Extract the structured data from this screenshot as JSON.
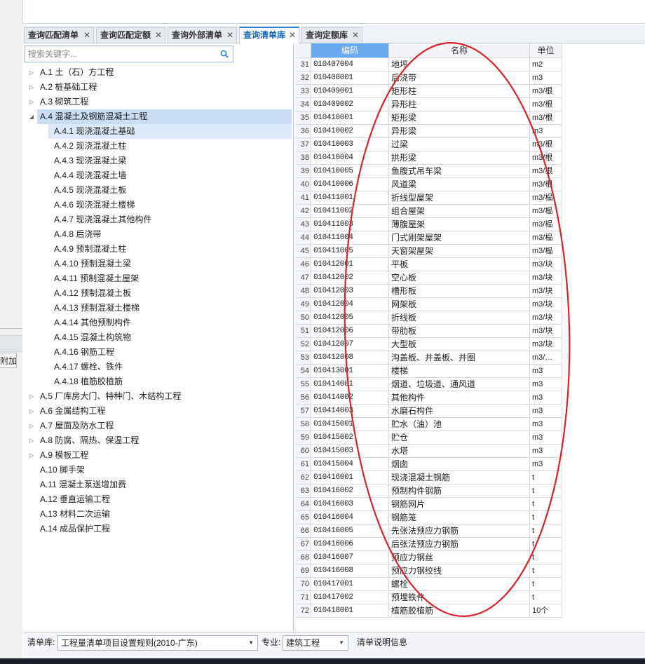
{
  "tabs": [
    {
      "label": "查询匹配清单",
      "active": false
    },
    {
      "label": "查询匹配定额",
      "active": false
    },
    {
      "label": "查询外部清单",
      "active": false
    },
    {
      "label": "查询清单库",
      "active": true
    },
    {
      "label": "查询定额库",
      "active": false
    }
  ],
  "left_strip_button": "附加",
  "search": {
    "placeholder": "搜索关键字..."
  },
  "tree": [
    {
      "label": "A.1 土（石）方工程",
      "level": 0,
      "caret": "right"
    },
    {
      "label": "A.2 桩基础工程",
      "level": 0,
      "caret": "right"
    },
    {
      "label": "A.3 砌筑工程",
      "level": 0,
      "caret": "right"
    },
    {
      "label": "A.4 混凝土及钢筋混凝土工程",
      "level": 0,
      "caret": "down",
      "highlight": true
    },
    {
      "label": "A.4.1 现浇混凝土基础",
      "level": 1,
      "selected": true
    },
    {
      "label": "A.4.2 现浇混凝土柱",
      "level": 1
    },
    {
      "label": "A.4.3 现浇混凝土梁",
      "level": 1
    },
    {
      "label": "A.4.4 现浇混凝土墙",
      "level": 1
    },
    {
      "label": "A.4.5 现浇混凝土板",
      "level": 1
    },
    {
      "label": "A.4.6 现浇混凝土楼梯",
      "level": 1
    },
    {
      "label": "A.4.7 现浇混凝土其他构件",
      "level": 1
    },
    {
      "label": "A.4.8 后浇带",
      "level": 1
    },
    {
      "label": "A.4.9 预制混凝土柱",
      "level": 1
    },
    {
      "label": "A.4.10 预制混凝土梁",
      "level": 1
    },
    {
      "label": "A.4.11 预制混凝土屋架",
      "level": 1
    },
    {
      "label": "A.4.12 预制混凝土板",
      "level": 1
    },
    {
      "label": "A.4.13 预制混凝土楼梯",
      "level": 1
    },
    {
      "label": "A.4.14 其他预制构件",
      "level": 1
    },
    {
      "label": "A.4.15 混凝土构筑物",
      "level": 1
    },
    {
      "label": "A.4.16 钢筋工程",
      "level": 1
    },
    {
      "label": "A.4.17 螺栓、铁件",
      "level": 1
    },
    {
      "label": "A.4.18 植筋胶植筋",
      "level": 1
    },
    {
      "label": "A.5 厂库房大门、特种门、木结构工程",
      "level": 0,
      "caret": "right"
    },
    {
      "label": "A.6 金属结构工程",
      "level": 0,
      "caret": "right"
    },
    {
      "label": "A.7 屋面及防水工程",
      "level": 0,
      "caret": "right"
    },
    {
      "label": "A.8 防腐、隔热、保温工程",
      "level": 0,
      "caret": "right"
    },
    {
      "label": "A.9 模板工程",
      "level": 0,
      "caret": "right"
    },
    {
      "label": "A.10 脚手架",
      "level": 0
    },
    {
      "label": "A.11 混凝土泵送增加费",
      "level": 0
    },
    {
      "label": "A.12 垂直运输工程",
      "level": 0
    },
    {
      "label": "A.13 材料二次运输",
      "level": 0
    },
    {
      "label": "A.14 成品保护工程",
      "level": 0
    }
  ],
  "grid": {
    "columns": {
      "code": "编码",
      "name": "名称",
      "unit": "单位"
    },
    "rows": [
      {
        "no": "31",
        "code": "010407004",
        "name": "地坪",
        "unit": "m2"
      },
      {
        "no": "32",
        "code": "010408001",
        "name": "后浇带",
        "unit": "m3"
      },
      {
        "no": "33",
        "code": "010409001",
        "name": "矩形柱",
        "unit": "m3/根"
      },
      {
        "no": "34",
        "code": "010409002",
        "name": "异形柱",
        "unit": "m3/根"
      },
      {
        "no": "35",
        "code": "010410001",
        "name": "矩形梁",
        "unit": "m3/根"
      },
      {
        "no": "36",
        "code": "010410002",
        "name": "异形梁",
        "unit": "m3"
      },
      {
        "no": "37",
        "code": "010410003",
        "name": "过梁",
        "unit": "m3/根"
      },
      {
        "no": "38",
        "code": "010410004",
        "name": "拱形梁",
        "unit": "m3/根"
      },
      {
        "no": "39",
        "code": "010410005",
        "name": "鱼腹式吊车梁",
        "unit": "m3/根"
      },
      {
        "no": "40",
        "code": "010410006",
        "name": "风道梁",
        "unit": "m3/根"
      },
      {
        "no": "41",
        "code": "010411001",
        "name": "折线型屋架",
        "unit": "m3/榀"
      },
      {
        "no": "42",
        "code": "010411002",
        "name": "组合屋架",
        "unit": "m3/榀"
      },
      {
        "no": "43",
        "code": "010411003",
        "name": "薄腹屋架",
        "unit": "m3/榀"
      },
      {
        "no": "44",
        "code": "010411004",
        "name": "门式刚架屋架",
        "unit": "m3/榀"
      },
      {
        "no": "45",
        "code": "010411005",
        "name": "天窗架屋架",
        "unit": "m3/榀"
      },
      {
        "no": "46",
        "code": "010412001",
        "name": "平板",
        "unit": "m3/块"
      },
      {
        "no": "47",
        "code": "010412002",
        "name": "空心板",
        "unit": "m3/块"
      },
      {
        "no": "48",
        "code": "010412003",
        "name": "槽形板",
        "unit": "m3/块"
      },
      {
        "no": "49",
        "code": "010412004",
        "name": "网架板",
        "unit": "m3/块"
      },
      {
        "no": "50",
        "code": "010412005",
        "name": "折线板",
        "unit": "m3/块"
      },
      {
        "no": "51",
        "code": "010412006",
        "name": "带肋板",
        "unit": "m3/块"
      },
      {
        "no": "52",
        "code": "010412007",
        "name": "大型板",
        "unit": "m3/块"
      },
      {
        "no": "53",
        "code": "010412008",
        "name": "沟盖板、井盖板、井圈",
        "unit": "m3/…"
      },
      {
        "no": "54",
        "code": "010413001",
        "name": "楼梯",
        "unit": "m3"
      },
      {
        "no": "55",
        "code": "010414001",
        "name": "烟道、垃圾道、通风道",
        "unit": "m3"
      },
      {
        "no": "56",
        "code": "010414002",
        "name": "其他构件",
        "unit": "m3"
      },
      {
        "no": "57",
        "code": "010414003",
        "name": "水磨石构件",
        "unit": "m3"
      },
      {
        "no": "58",
        "code": "010415001",
        "name": "贮水（油）池",
        "unit": "m3"
      },
      {
        "no": "59",
        "code": "010415002",
        "name": "贮仓",
        "unit": "m3"
      },
      {
        "no": "60",
        "code": "010415003",
        "name": "水塔",
        "unit": "m3"
      },
      {
        "no": "61",
        "code": "010415004",
        "name": "烟囱",
        "unit": "m3"
      },
      {
        "no": "62",
        "code": "010416001",
        "name": "现浇混凝土钢筋",
        "unit": "t"
      },
      {
        "no": "63",
        "code": "010416002",
        "name": "预制构件钢筋",
        "unit": "t"
      },
      {
        "no": "64",
        "code": "010416003",
        "name": "钢筋网片",
        "unit": "t"
      },
      {
        "no": "65",
        "code": "010416004",
        "name": "钢筋笼",
        "unit": "t"
      },
      {
        "no": "66",
        "code": "010416005",
        "name": "先张法预应力钢筋",
        "unit": "t"
      },
      {
        "no": "67",
        "code": "010416006",
        "name": "后张法预应力钢筋",
        "unit": "t"
      },
      {
        "no": "68",
        "code": "010416007",
        "name": "预应力钢丝",
        "unit": "t"
      },
      {
        "no": "69",
        "code": "010416008",
        "name": "预应力钢绞线",
        "unit": "t"
      },
      {
        "no": "70",
        "code": "010417001",
        "name": "螺栓",
        "unit": "t"
      },
      {
        "no": "71",
        "code": "010417002",
        "name": "预埋铁件",
        "unit": "t"
      },
      {
        "no": "72",
        "code": "010418001",
        "name": "植筋胶植筋",
        "unit": "10个"
      }
    ]
  },
  "bottom": {
    "library_label": "清单库:",
    "library_value": "工程量清单项目设置规则(2010-广东)",
    "specialty_label": "专业:",
    "specialty_value": "建筑工程",
    "info_label": "清单说明信息"
  },
  "colors": {
    "accent": "#2f7fd6",
    "header_code": "#6aaaf0",
    "annotation": "#e0202a"
  }
}
